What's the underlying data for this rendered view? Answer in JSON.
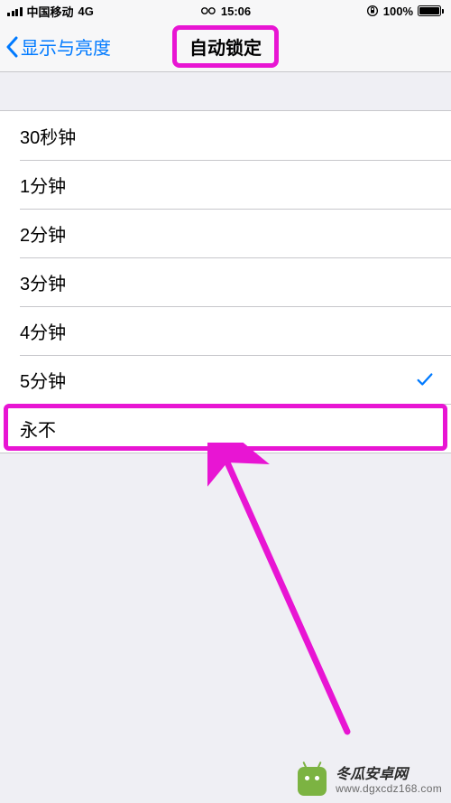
{
  "status": {
    "carrier": "中国移动",
    "network": "4G",
    "time": "15:06",
    "battery_pct": "100%",
    "lock_icon": "orientation-lock"
  },
  "nav": {
    "back_label": "显示与亮度",
    "title": "自动锁定"
  },
  "options": [
    {
      "label": "30秒钟",
      "selected": false
    },
    {
      "label": "1分钟",
      "selected": false
    },
    {
      "label": "2分钟",
      "selected": false
    },
    {
      "label": "3分钟",
      "selected": false
    },
    {
      "label": "4分钟",
      "selected": false
    },
    {
      "label": "5分钟",
      "selected": true
    },
    {
      "label": "永不",
      "selected": false
    }
  ],
  "annotation": {
    "highlight_title": true,
    "highlight_option_index": 6,
    "arrow_color": "#e815d3"
  },
  "watermark": {
    "title": "冬瓜安卓网",
    "url": "www.dgxcdz168.com"
  }
}
